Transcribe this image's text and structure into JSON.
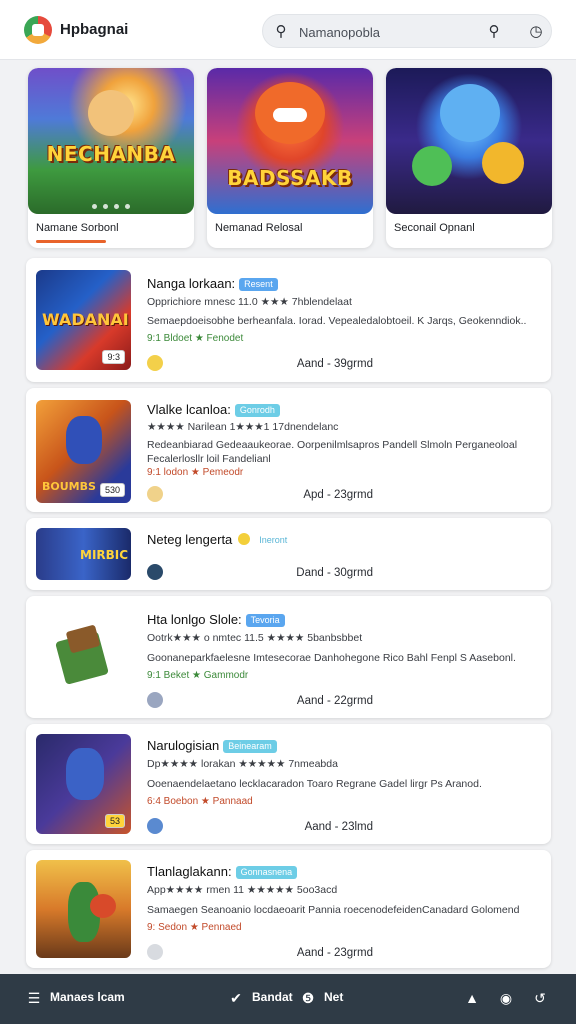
{
  "header": {
    "app_name": "Hpbagnai",
    "search_placeholder": "Namanopobla"
  },
  "featured": [
    {
      "wordmark": "NECHANBA",
      "label": "Namane Sorbonl"
    },
    {
      "wordmark": "BADSSAKB",
      "label": "Nemanad Relosal"
    },
    {
      "wordmark": "",
      "label": "Seconail Opnanl"
    }
  ],
  "list": [
    {
      "title": "Nanga lorkaan:",
      "chip": "Resent",
      "line1": "Opprichiore mnesc 11.0 ★★★ 7hblendelaat",
      "line2": "Semaepdoeisobhe berheanfala. Iorad. Vepealedalobtoeil. K Jarqs, Geokenndiok..",
      "meta": "9:1 Bldoet ★ Fenodet",
      "price": "Aand - 39grmd",
      "thumb_word": "WADANAI",
      "tag": "9:3"
    },
    {
      "title": "Vlalke lcanloa:",
      "chip": "Gonrodh",
      "line1": "★★★★ Narilean 1★★★1 17dnendelanc",
      "line2": "Redeanbiarad Gedeaaukeorae. Oorpenilmlsapros Pandell Slmoln Perganeoloal",
      "line3": "Fecalerlosllr loil Fandelianl",
      "meta": "9:1 lodon ★ Pemeodr",
      "price": "Apd - 23grmd",
      "thumb_word": "BOUMBS",
      "tag": "530"
    },
    {
      "title": "Neteg lengerta",
      "chip": "Ineront",
      "price": "Dand - 30grmd",
      "thumb_word": "MIRBIC"
    },
    {
      "title": "Hta lonlgo Slole:",
      "chip": "Tevoria",
      "line1": "Ootrk★★★ o nmtec 11.5 ★★★★ 5banbsbbet",
      "line2": "Goonaneparkfaelesne Imtesecorae Danhohegone Rico Bahl Fenpl S Aasebonl.",
      "meta": "9:1 Beket ★ Gammodr",
      "price": "Aand - 22grmd"
    },
    {
      "title": "Narulogisian",
      "chip": "Beinearam",
      "line1": "Dp★★★★ lorakan ★★★★★ 7nmeabda",
      "line2": "Ooenaendelaetano lecklacaradon Toaro Regrane Gadel lirgr Ps Aranod.",
      "meta": "6:4 Boebon ★ Pannaad",
      "price": "Aand - 23lmd",
      "tag": "53"
    },
    {
      "title": "Tlanlaglakann:",
      "chip": "Gonnasnena",
      "line1": "App★★★★ rmen 11 ★★★★★ 5oo3acd",
      "line2": "Samaegen Seanoanio locdaeoarit Pannia roecenodefeidenCanadard Golomend",
      "meta": "9: Sedon ★ Pennaed",
      "price": "Aand - 23grmd"
    }
  ],
  "bottom_nav": {
    "left": "Manaes lcam",
    "mid1": "Bandat",
    "mid2": "Net"
  },
  "colors": {
    "accent": "#e8632a",
    "chip": "#5aa6ef",
    "bottom_bar": "#2f3b46",
    "star": "#e9a230"
  }
}
